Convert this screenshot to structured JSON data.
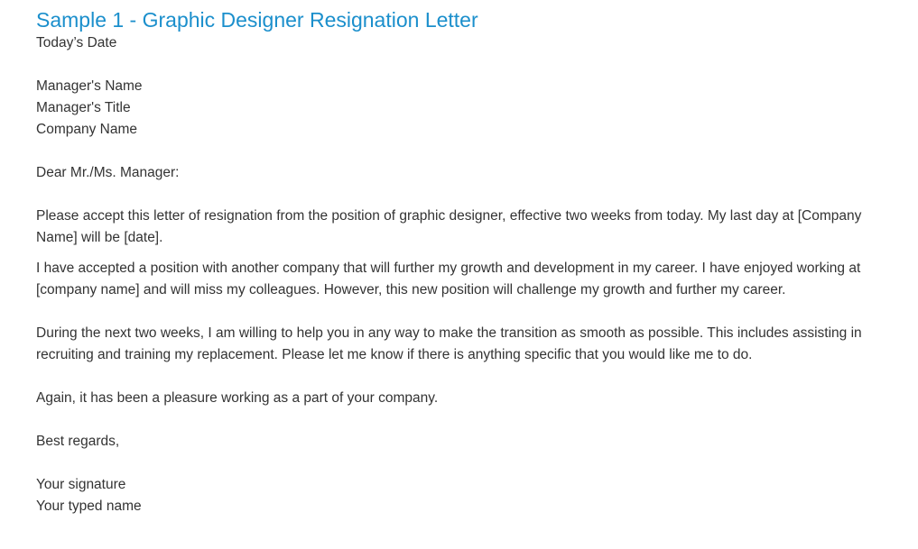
{
  "letter": {
    "title": "Sample 1 - Graphic Designer Resignation Letter",
    "date": "Today’s Date",
    "recipient": {
      "name": "Manager's Name",
      "title": "Manager's Title",
      "company": "Company Name"
    },
    "salutation": "Dear Mr./Ms. Manager:",
    "paragraphs": [
      "Please accept this letter of resignation from the position of graphic designer, effective two weeks from today. My last day at [Company Name] will be [date].",
      "I have accepted a position with another company that will further my growth and development in my career. I have enjoyed working at [company name] and will miss my colleagues. However, this new position will challenge my growth and further my career.",
      "During the next two weeks, I am willing to help you in any way to make the transition as smooth as possible. This includes assisting in recruiting and training my replacement. Please let me know if there is anything specific that you would like me to do.",
      "Again, it has been a pleasure working as a part of your company."
    ],
    "closing": "Best regards,",
    "signature": "Your signature",
    "typed_name": "Your typed name"
  }
}
